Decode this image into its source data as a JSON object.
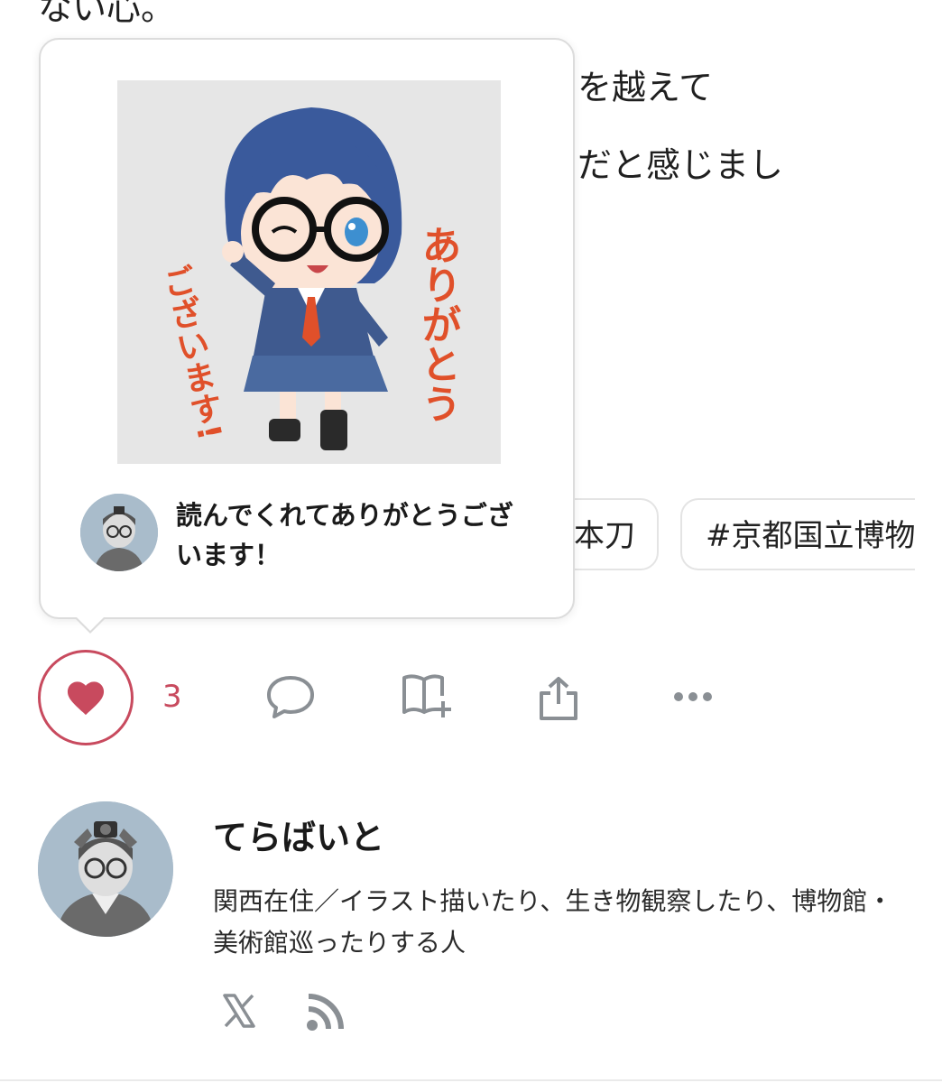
{
  "article": {
    "line_top": "ない心。",
    "line_1_visible": "を越えて",
    "line_2_visible": "だと感じまし"
  },
  "tags": [
    {
      "label": "本刀"
    },
    {
      "label": "#京都国立博物"
    }
  ],
  "popup": {
    "sticker": {
      "text_right": "ありがとう",
      "text_left": "ございます!"
    },
    "message": "読んでくれてありがとうございます！"
  },
  "actions": {
    "like_count": "3"
  },
  "author": {
    "name": "てらばいと",
    "bio": "関西在住／イラスト描いたり、生き物観察したり、博物館・美術館巡ったりする人"
  },
  "colors": {
    "like_accent": "#c84a5e",
    "icon_gray": "#8a8f94",
    "sticker_text": "#e0502a",
    "hair_blue": "#3a5a9c"
  }
}
